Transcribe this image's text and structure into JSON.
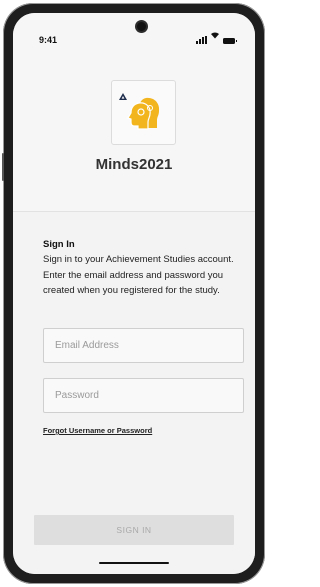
{
  "status_bar": {
    "time": "9:41",
    "icons": [
      "signal-icon",
      "wifi-icon",
      "battery-icon"
    ]
  },
  "app": {
    "logo_icon": "minds-heads-logo-icon",
    "badge_icon": "triangle-icon",
    "title": "Minds2021"
  },
  "sign_in": {
    "heading": "Sign In",
    "description": "Sign in to your Achievement Studies account. Enter the email address and password you created when you registered for the study.",
    "email_placeholder": "Email Address",
    "email_value": "",
    "password_placeholder": "Password",
    "password_value": "",
    "forgot_link": "Forgot Username or Password",
    "submit_label": "SIGN IN"
  },
  "colors": {
    "logo_yellow": "#f2b51d",
    "logo_navy": "#1f2d4d",
    "button_disabled_bg": "#dedede",
    "button_disabled_text": "#a9a9a9"
  }
}
